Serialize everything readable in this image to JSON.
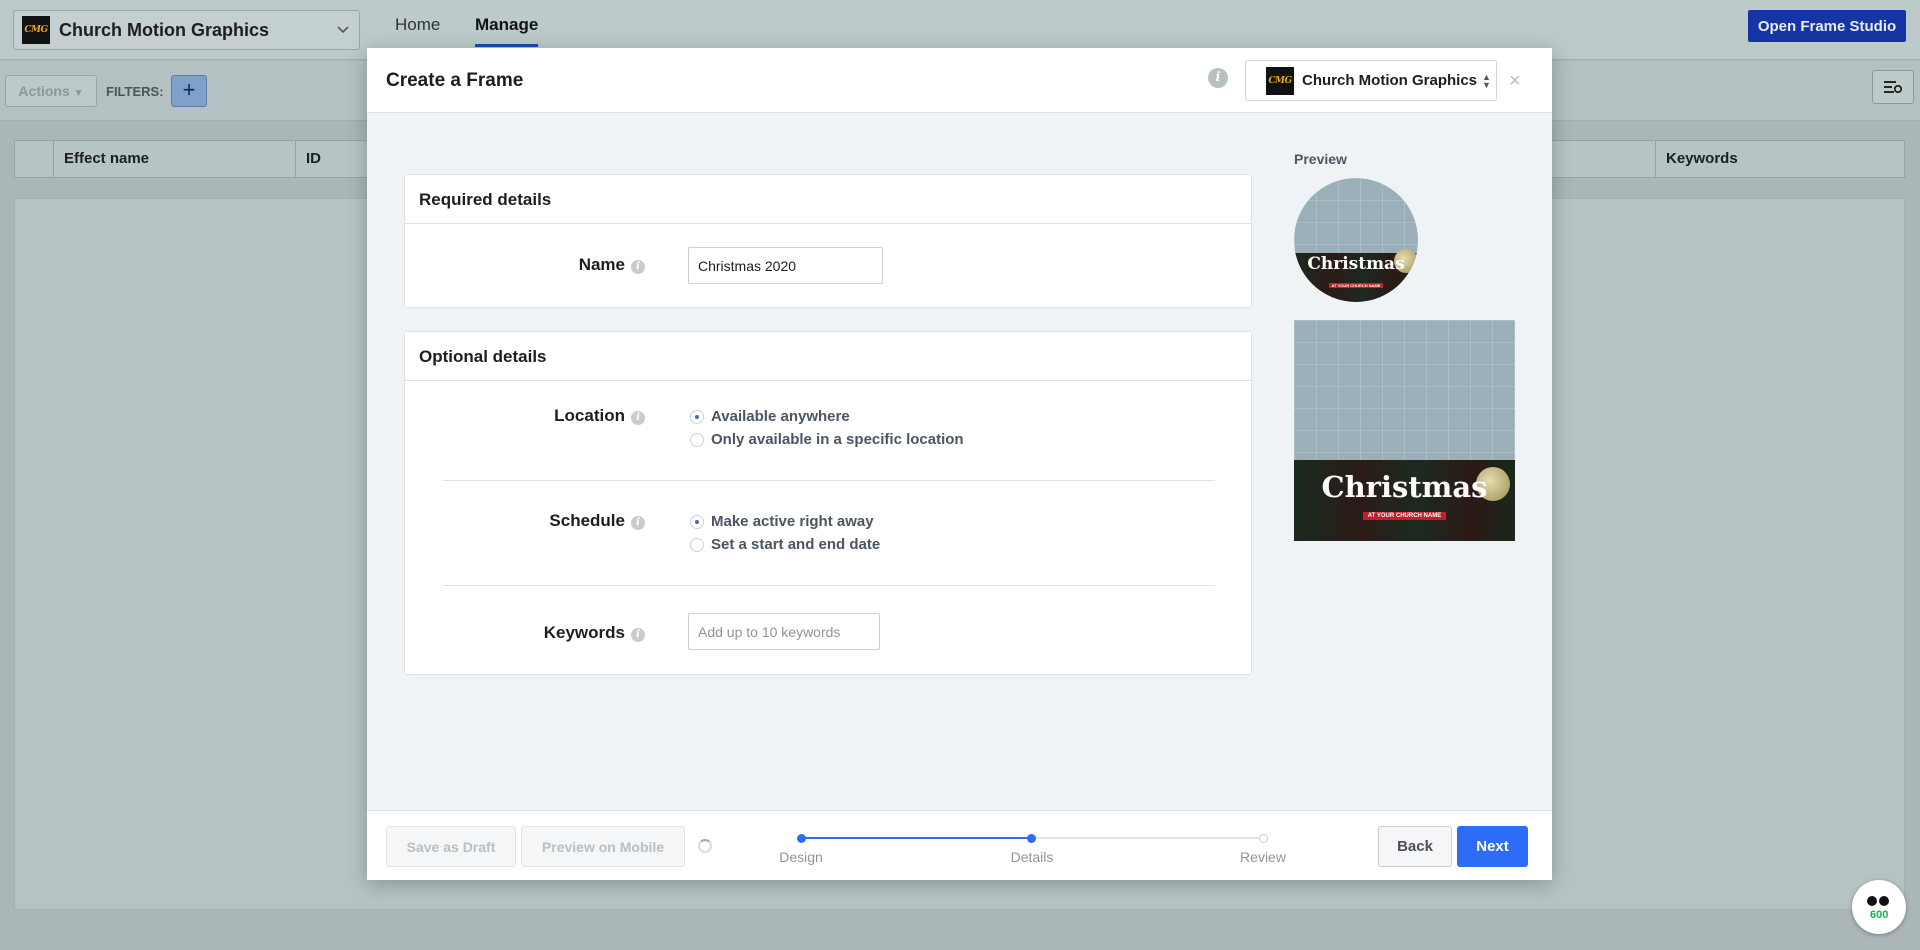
{
  "app": {
    "page_name": "Church Motion Graphics",
    "logo_text": "CMG",
    "nav": {
      "home": "Home",
      "manage": "Manage"
    },
    "open_studio": "Open Frame Studio",
    "toolbar": {
      "actions": "Actions",
      "filters": "FILTERS:",
      "add": "+"
    },
    "table_headers": [
      "Effect name",
      "ID",
      "Keywords"
    ],
    "notification_count": "600"
  },
  "modal": {
    "title": "Create a Frame",
    "page_picker": "Church Motion Graphics",
    "close": "×",
    "required": {
      "heading": "Required details",
      "name_label": "Name",
      "name_value": "Christmas 2020"
    },
    "optional": {
      "heading": "Optional details",
      "location_label": "Location",
      "location_options": [
        "Available anywhere",
        "Only available in a specific location"
      ],
      "location_selected": 0,
      "schedule_label": "Schedule",
      "schedule_options": [
        "Make active right away",
        "Set a start and end date"
      ],
      "schedule_selected": 0,
      "keywords_label": "Keywords",
      "keywords_placeholder": "Add up to 10 keywords"
    },
    "preview": {
      "label": "Preview",
      "frame_title": "Christmas",
      "frame_subtitle": "AT YOUR CHURCH NAME"
    },
    "footer": {
      "save_draft": "Save as Draft",
      "preview_mobile": "Preview on Mobile",
      "steps": [
        "Design",
        "Details",
        "Review"
      ],
      "current_step": 1,
      "back": "Back",
      "next": "Next"
    }
  },
  "colors": {
    "primary": "#2d6cf5",
    "studio_button": "#1634a3",
    "banner_red": "#c41e2a"
  }
}
